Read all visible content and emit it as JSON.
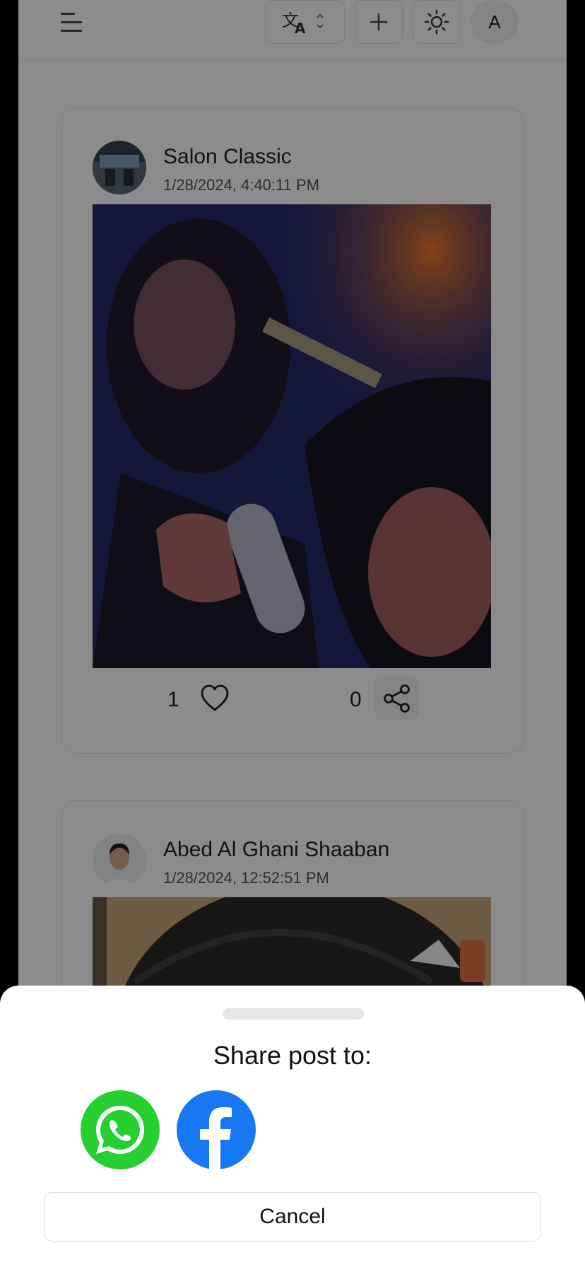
{
  "header": {
    "menu_icon": "menu-icon",
    "translate_icon": "translate-icon",
    "add_icon": "plus-icon",
    "theme_icon": "sun-icon",
    "avatar_initial": "A"
  },
  "posts": [
    {
      "author": "Salon Classic",
      "timestamp": "1/28/2024, 4:40:11 PM",
      "likes": "1",
      "shares": "0"
    },
    {
      "author": "Abed Al Ghani Shaaban",
      "timestamp": "1/28/2024, 12:52:51 PM"
    }
  ],
  "share_sheet": {
    "title": "Share post to:",
    "targets": [
      "whatsapp-icon",
      "facebook-icon"
    ],
    "cancel_label": "Cancel"
  },
  "colors": {
    "whatsapp": "#25d030",
    "facebook": "#1877f2",
    "overlay": "rgba(0,0,0,0.45)"
  }
}
